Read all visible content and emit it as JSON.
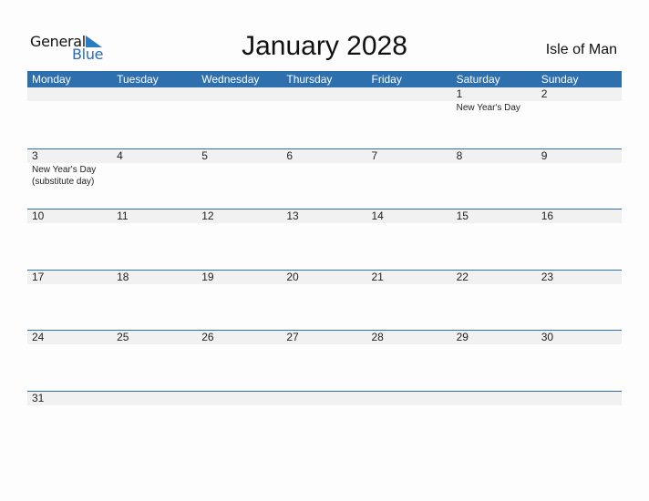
{
  "logo": {
    "line1": "General",
    "line2": "Blue"
  },
  "title": "January 2028",
  "country": "Isle of Man",
  "weekdays": [
    "Monday",
    "Tuesday",
    "Wednesday",
    "Thursday",
    "Friday",
    "Saturday",
    "Sunday"
  ],
  "weeks": [
    [
      {
        "d": ""
      },
      {
        "d": ""
      },
      {
        "d": ""
      },
      {
        "d": ""
      },
      {
        "d": ""
      },
      {
        "d": "1",
        "h": "New Year's Day"
      },
      {
        "d": "2"
      }
    ],
    [
      {
        "d": "3",
        "h": "New Year's Day (substitute day)"
      },
      {
        "d": "4"
      },
      {
        "d": "5"
      },
      {
        "d": "6"
      },
      {
        "d": "7"
      },
      {
        "d": "8"
      },
      {
        "d": "9"
      }
    ],
    [
      {
        "d": "10"
      },
      {
        "d": "11"
      },
      {
        "d": "12"
      },
      {
        "d": "13"
      },
      {
        "d": "14"
      },
      {
        "d": "15"
      },
      {
        "d": "16"
      }
    ],
    [
      {
        "d": "17"
      },
      {
        "d": "18"
      },
      {
        "d": "19"
      },
      {
        "d": "20"
      },
      {
        "d": "21"
      },
      {
        "d": "22"
      },
      {
        "d": "23"
      }
    ],
    [
      {
        "d": "24"
      },
      {
        "d": "25"
      },
      {
        "d": "26"
      },
      {
        "d": "27"
      },
      {
        "d": "28"
      },
      {
        "d": "29"
      },
      {
        "d": "30"
      }
    ],
    [
      {
        "d": "31"
      },
      {
        "d": ""
      },
      {
        "d": ""
      },
      {
        "d": ""
      },
      {
        "d": ""
      },
      {
        "d": ""
      },
      {
        "d": ""
      }
    ]
  ],
  "colors": {
    "accent": "#2e6fae",
    "band": "#f1f1f1"
  }
}
